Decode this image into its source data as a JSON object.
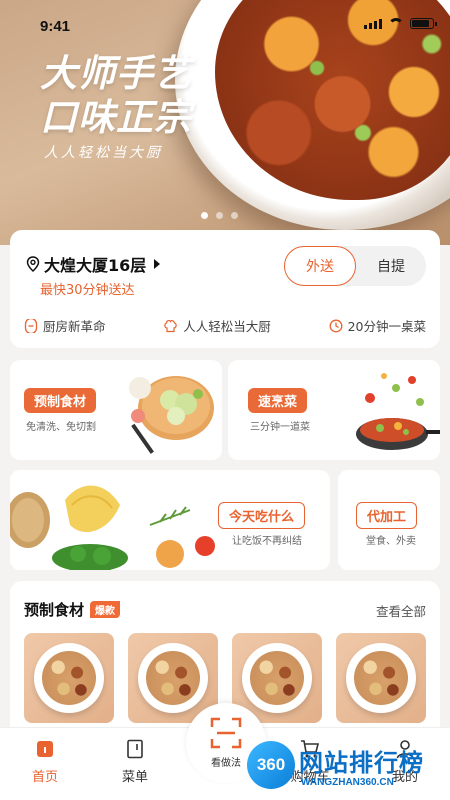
{
  "status": {
    "time": "9:41"
  },
  "hero": {
    "title_line1": "大师手艺",
    "title_line2": "口味正宗",
    "subtitle": "人人轻松当大厨",
    "carousel_count": 3,
    "carousel_active": 1
  },
  "store": {
    "name": "大煌大厦16层",
    "eta": "最快30分钟送达",
    "modes": [
      "外送",
      "自提"
    ],
    "active_mode": "外送",
    "tags": [
      "厨房新革命",
      "人人轻松当大厨",
      "20分钟一桌菜"
    ]
  },
  "categories": [
    {
      "title": "预制食材",
      "desc": "免清洗、免切割"
    },
    {
      "title": "速烹菜",
      "desc": "三分钟一道菜"
    },
    {
      "title": "今天吃什么",
      "desc": "让吃饭不再纠结"
    },
    {
      "title": "代加工",
      "desc": "堂食、外卖"
    }
  ],
  "products": {
    "title": "预制食材",
    "badge": "爆款",
    "see_all": "查看全部"
  },
  "tabbar": {
    "items": [
      "首页",
      "菜单",
      "看做法",
      "购物车",
      "我的"
    ],
    "active": "首页"
  },
  "watermark": {
    "badge": "360",
    "text": "网站排行榜",
    "url": "WANGZHAN360.CN"
  },
  "colors": {
    "accent": "#e8632f",
    "watermark": "#0b6fc6"
  }
}
